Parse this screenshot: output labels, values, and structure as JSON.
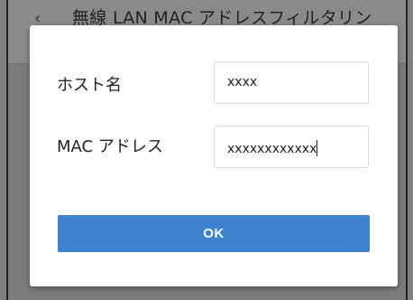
{
  "background": {
    "back_icon": "back-arrow-icon",
    "title": "無線 LAN MAC アドレスフィルタリン"
  },
  "dialog": {
    "host": {
      "label": "ホスト名",
      "value": "xxxx"
    },
    "mac": {
      "label": "MAC アドレス",
      "value": "xxxxxxxxxxxx"
    },
    "ok_label": "OK"
  },
  "colors": {
    "accent": "#3d83cf",
    "overlay": "#7f7f7f",
    "dialog_bg": "#ffffff"
  }
}
